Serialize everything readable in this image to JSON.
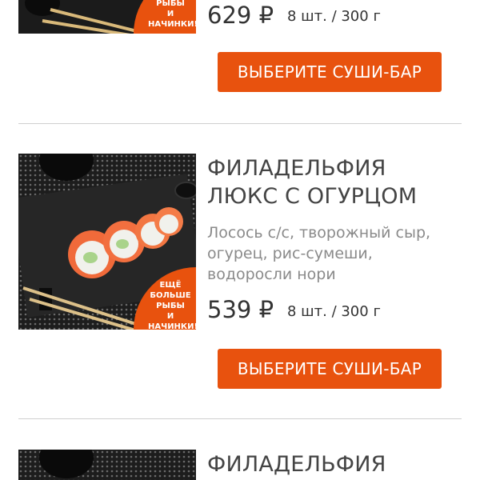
{
  "colors": {
    "accent": "#e8520e",
    "text": "#333333",
    "muted": "#8a8a8a",
    "divider": "#cfcfcf"
  },
  "products": [
    {
      "title_lines": [],
      "description": "",
      "price": "629 ₽",
      "weight": "8 шт. / 300 г",
      "promo_lines": [
        "РЫБЫ",
        "И НАЧИНКИ!"
      ],
      "button": "ВЫБЕРИТЕ СУШИ-БАР"
    },
    {
      "title_lines": [
        "ФИЛАДЕЛЬФИЯ",
        "ЛЮКС С ОГУРЦОМ"
      ],
      "description": "Лосось с/с, творожный сыр, огурец, рис-сумеши, водоросли нори",
      "price": "539 ₽",
      "weight": "8 шт. / 300 г",
      "promo_lines": [
        "ЕЩЁ БОЛЬШЕ",
        "РЫБЫ",
        "И НАЧИНКИ!"
      ],
      "button": "ВЫБЕРИТЕ СУШИ-БАР"
    },
    {
      "title_lines": [
        "ФИЛАДЕЛЬФИЯ"
      ]
    }
  ]
}
